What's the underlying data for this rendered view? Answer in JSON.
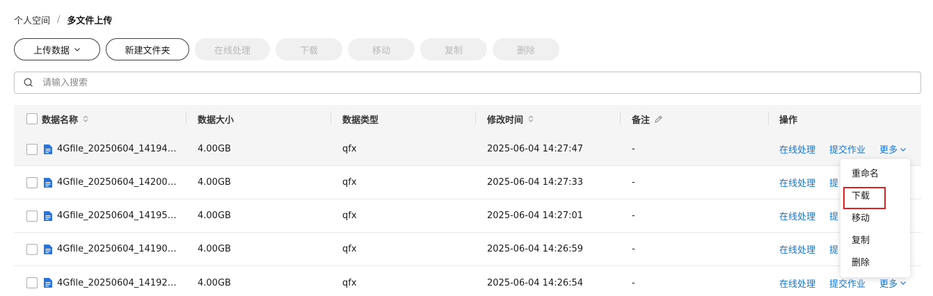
{
  "breadcrumb": {
    "parent": "个人空间",
    "separator": "/",
    "current": "多文件上传"
  },
  "toolbar": {
    "upload": "上传数据",
    "new_folder": "新建文件夹",
    "online": "在线处理",
    "download": "下载",
    "move": "移动",
    "copy": "复制",
    "delete": "删除"
  },
  "search": {
    "placeholder": "请输入搜索"
  },
  "table": {
    "headers": {
      "name": "数据名称",
      "size": "数据大小",
      "type": "数据类型",
      "mtime": "修改时间",
      "note": "备注",
      "ops": "操作"
    },
    "rows": [
      {
        "name": "4Gfile_20250604_14194…",
        "size": "4.00GB",
        "type": "qfx",
        "mtime": "2025-06-04 14:27:47",
        "note": "-",
        "op1": "在线处理",
        "op2": "提交作业",
        "op3": "更多"
      },
      {
        "name": "4Gfile_20250604_14200…",
        "size": "4.00GB",
        "type": "qfx",
        "mtime": "2025-06-04 14:27:33",
        "note": "-",
        "op1": "在线处理",
        "op2": "提"
      },
      {
        "name": "4Gfile_20250604_14195…",
        "size": "4.00GB",
        "type": "qfx",
        "mtime": "2025-06-04 14:27:01",
        "note": "-",
        "op1": "在线处理",
        "op2": "提"
      },
      {
        "name": "4Gfile_20250604_14190…",
        "size": "4.00GB",
        "type": "qfx",
        "mtime": "2025-06-04 14:26:59",
        "note": "-",
        "op1": "在线处理",
        "op2": "提"
      },
      {
        "name": "4Gfile_20250604_14192…",
        "size": "4.00GB",
        "type": "qfx",
        "mtime": "2025-06-04 14:26:54",
        "note": "-",
        "op1": "在线处理",
        "op2": "提交作业",
        "op3": "更多"
      }
    ]
  },
  "dropdown": {
    "items": [
      "重命名",
      "下载",
      "移动",
      "复制",
      "删除"
    ]
  },
  "colors": {
    "link": "#1476d6",
    "highlight_border": "#e02020",
    "file_icon": "#2a73d9"
  }
}
